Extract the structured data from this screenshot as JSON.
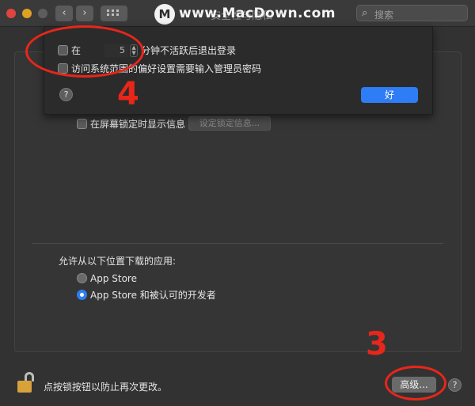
{
  "titlebar": {
    "title_partial": "安全性与隐私",
    "search_placeholder": "搜索"
  },
  "watermark": {
    "logo_letter": "M",
    "text": "www.MacDown.com"
  },
  "sheet": {
    "logout_prefix": "在",
    "logout_minutes": "5",
    "logout_suffix": "分钟不活跃后退出登录",
    "admin_password_label": "访问系统范围的偏好设置需要输入管理员密码",
    "ok_label": "好",
    "help_label": "?"
  },
  "general": {
    "show_message_label": "在屏幕锁定时显示信息",
    "set_message_button": "设定锁定信息..."
  },
  "downloads": {
    "section_label": "允许从以下位置下载的应用:",
    "options": [
      {
        "label": "App Store",
        "selected": false
      },
      {
        "label": "App Store 和被认可的开发者",
        "selected": true
      }
    ]
  },
  "footer": {
    "lock_message": "点按锁按钮以防止再次更改。",
    "advanced_button": "高级...",
    "help_label": "?"
  },
  "annotations": {
    "step3": "3",
    "step4": "4",
    "color": "#e8261a"
  },
  "colors": {
    "accent": "#2e7cf6",
    "window_bg": "#323232"
  }
}
